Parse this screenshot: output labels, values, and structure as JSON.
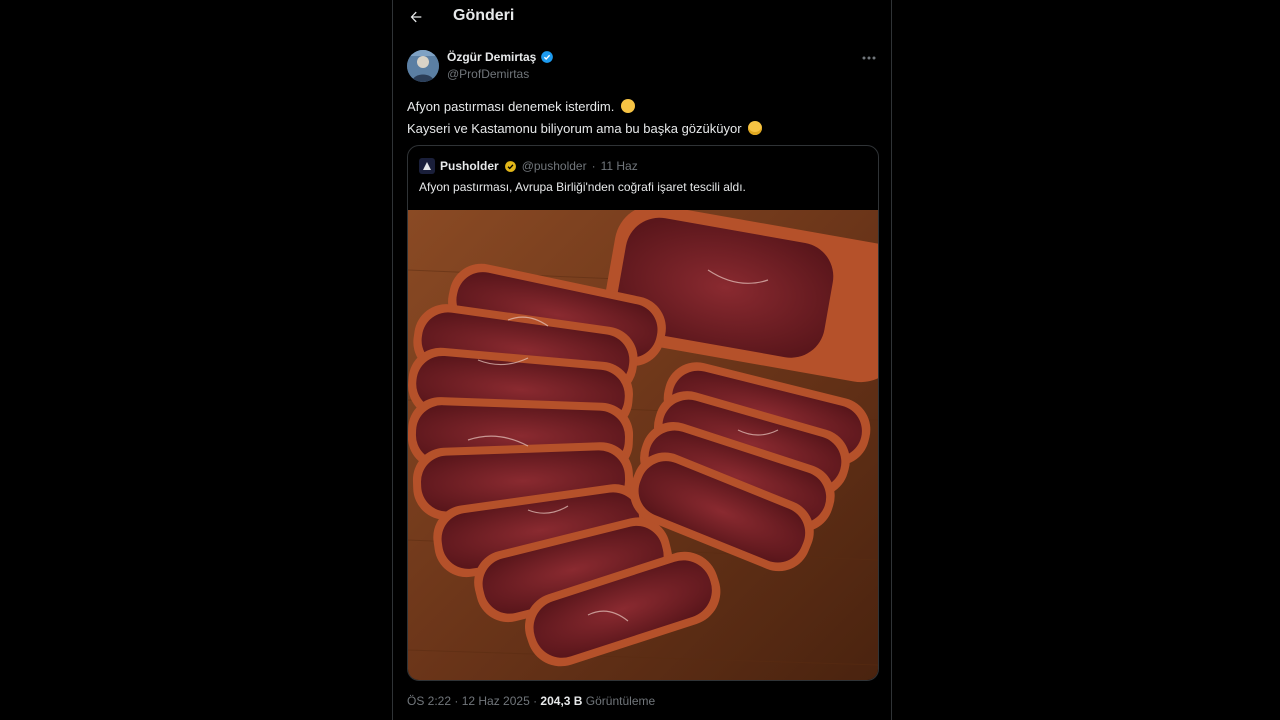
{
  "header": {
    "title": "Gönderi"
  },
  "tweet": {
    "author_name": "Özgür Demirtaş",
    "author_handle": "@ProfDemirtas",
    "text_line1": "Afyon pastırması denemek isterdim.",
    "text_line2": "Kayseri ve Kastamonu biliyorum ama bu başka gözüküyor",
    "timestamp": "ÖS 2:22 · 12 Haz 2025",
    "separator": " · ",
    "views_count": "204,3 B",
    "views_label": "Görüntüleme"
  },
  "quote": {
    "author_name": "Pusholder",
    "author_handle": "@pusholder",
    "date": "11 Haz",
    "separator": "·",
    "text": "Afyon pastırması, Avrupa Birliği'nden coğrafi işaret tescili aldı."
  },
  "icons": {
    "back": "arrow-left-icon",
    "verified_blue": "verified-blue-icon",
    "verified_gold": "verified-gold-icon",
    "more": "more-dots-icon"
  },
  "colors": {
    "background": "#000000",
    "text": "#e7e9ea",
    "muted": "#71767b",
    "verified": "#1d9bf0",
    "gold": "#e2b719"
  }
}
